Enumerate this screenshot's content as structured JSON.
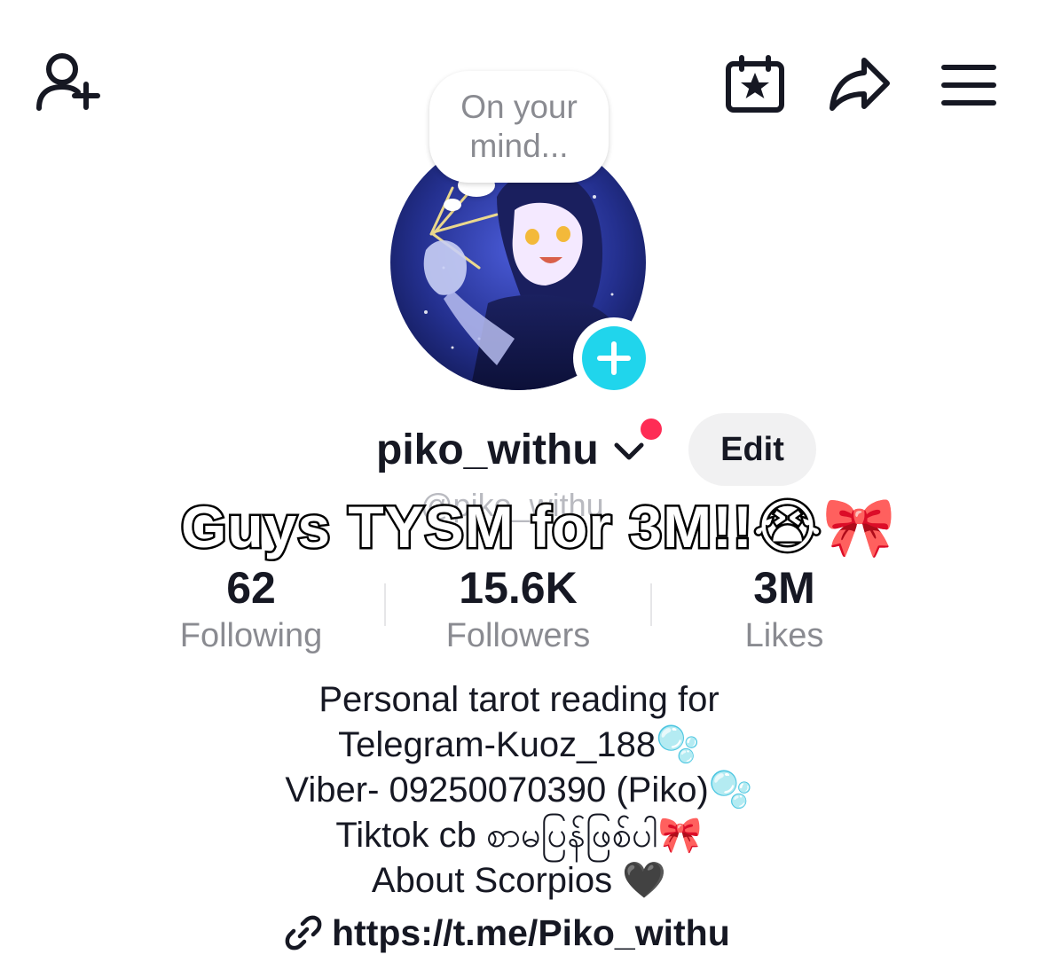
{
  "header": {
    "add_friend_icon": "person-plus-icon",
    "calendar_icon": "calendar-star-icon",
    "share_icon": "share-arrow-icon",
    "menu_icon": "hamburger-menu-icon"
  },
  "bubble": {
    "text": "On your mind..."
  },
  "profile": {
    "username": "piko_withu",
    "handle": "@piko_withu",
    "edit_label": "Edit",
    "overlay_caption": "Guys TYSM for 3M!!😭🎀"
  },
  "stats": [
    {
      "value": "62",
      "label": "Following"
    },
    {
      "value": "15.6K",
      "label": "Followers"
    },
    {
      "value": "3M",
      "label": "Likes"
    }
  ],
  "bio": {
    "lines": [
      "Personal tarot reading for",
      "Telegram-Kuoz_188🫧",
      "Viber- 09250070390 (Piko)🫧",
      "Tiktok cb စာမပြန်ဖြစ်ပါ🎀",
      "About Scorpios 🖤"
    ],
    "link": "https://t.me/Piko_withu"
  },
  "colors": {
    "accent_cyan": "#20D5EC",
    "notification_red": "#FE2C55",
    "secondary_text": "#8a8b91"
  }
}
